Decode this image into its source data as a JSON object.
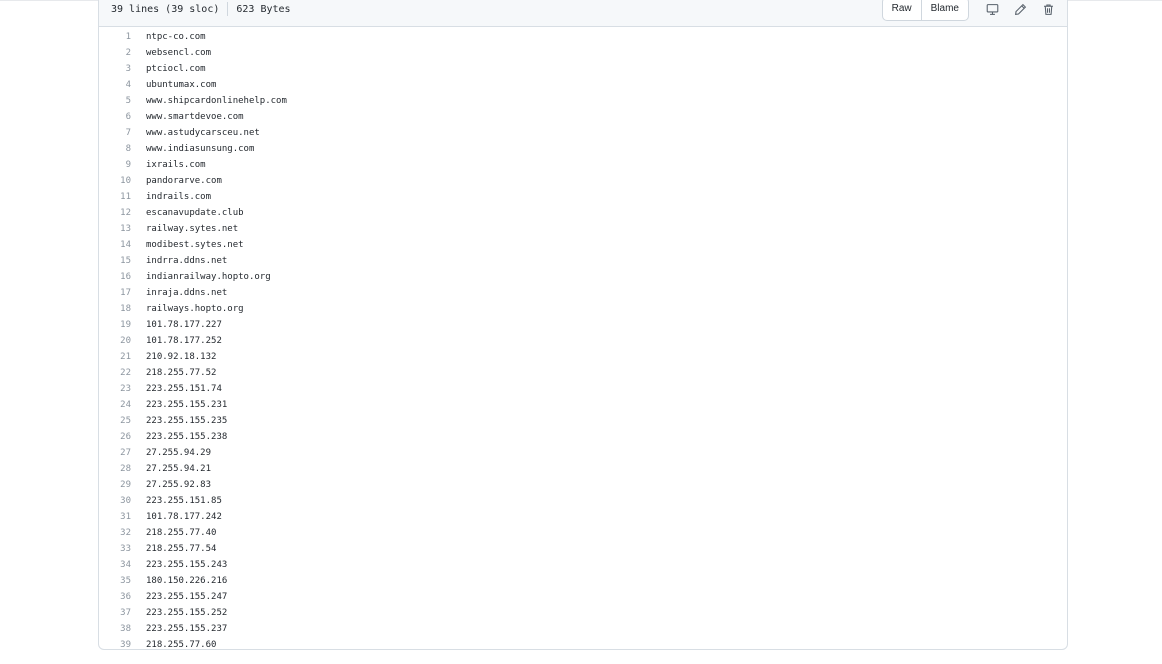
{
  "file": {
    "lines_info": "39 lines (39 sloc)",
    "size_info": "623 Bytes"
  },
  "actions": {
    "raw_label": "Raw",
    "blame_label": "Blame",
    "icons": [
      "desktop-icon",
      "pencil-icon",
      "trash-icon"
    ]
  },
  "lines": [
    "ntpc-co.com",
    "websencl.com",
    "ptciocl.com",
    "ubuntumax.com",
    "www.shipcardonlinehelp.com",
    "www.smartdevoe.com",
    "www.astudycarsceu.net",
    "www.indiasunsung.com",
    "ixrails.com",
    "pandorarve.com",
    "indrails.com",
    "escanavupdate.club",
    "railway.sytes.net",
    "modibest.sytes.net",
    "indrra.ddns.net",
    "indianrailway.hopto.org",
    "inraja.ddns.net",
    "railways.hopto.org",
    "101.78.177.227",
    "101.78.177.252",
    "210.92.18.132",
    "218.255.77.52",
    "223.255.151.74",
    "223.255.155.231",
    "223.255.155.235",
    "223.255.155.238",
    "27.255.94.29",
    "27.255.94.21",
    "27.255.92.83",
    "223.255.151.85",
    "101.78.177.242",
    "218.255.77.40",
    "218.255.77.54",
    "223.255.155.243",
    "180.150.226.216",
    "223.255.155.247",
    "223.255.155.252",
    "223.255.155.237",
    "218.255.77.60"
  ]
}
